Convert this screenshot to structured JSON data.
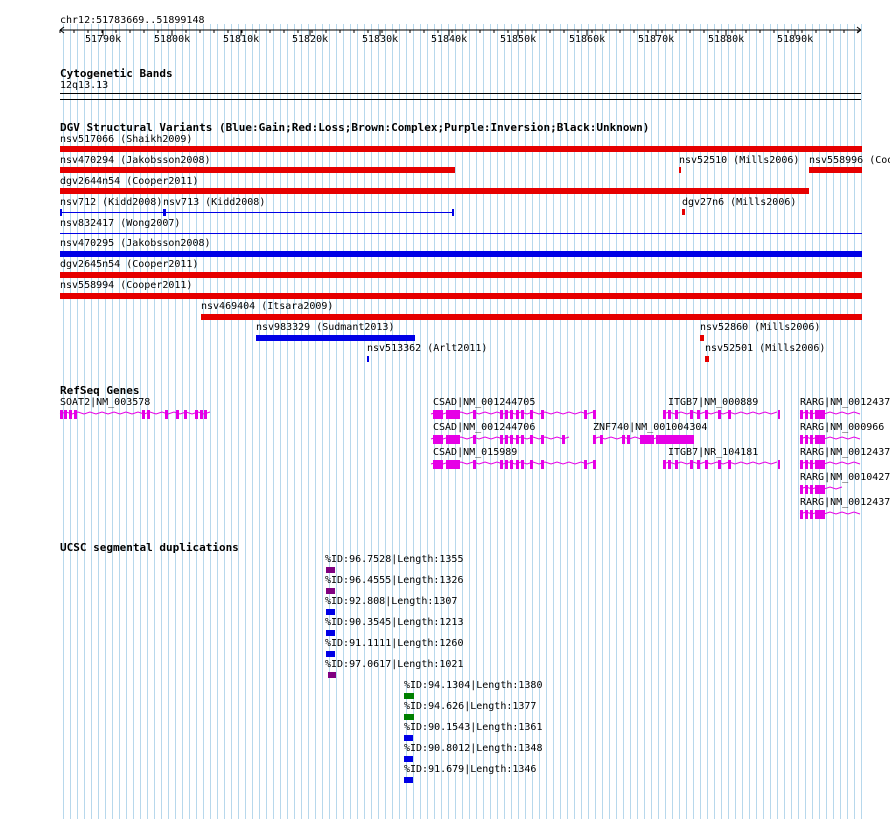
{
  "region": "chr12:51783669..51899148",
  "ruler": {
    "ticks": [
      "51790k",
      "51800k",
      "51810k",
      "51820k",
      "51830k",
      "51840k",
      "51850k",
      "51860k",
      "51870k",
      "51880k",
      "51890k"
    ]
  },
  "cyto": {
    "title": "Cytogenetic Bands",
    "band": "12q13.13"
  },
  "dgv": {
    "title": "DGV Structural Variants (Blue:Gain;Red:Loss;Brown:Complex;Purple:Inversion;Black:Unknown)",
    "variants": [
      {
        "label": "nsv517066 (Shaikh2009)",
        "color": "#e60000"
      },
      {
        "label": "nsv470294 (Jakobsson2008)",
        "color": "#e60000"
      },
      {
        "label": "nsv52510 (Mills2006)",
        "color": "#e60000"
      },
      {
        "label": "nsv558996 (Coo",
        "color": "#e60000"
      },
      {
        "label": "dgv2644n54 (Cooper2011)",
        "color": "#e60000"
      },
      {
        "label": "nsv712 (Kidd2008)",
        "color": "#0000e6"
      },
      {
        "label": "nsv713 (Kidd2008)",
        "color": "#0000e6"
      },
      {
        "label": "dgv27n6 (Mills2006)",
        "color": "#e60000"
      },
      {
        "label": "nsv832417 (Wong2007)",
        "color": "#0000e6"
      },
      {
        "label": "nsv470295 (Jakobsson2008)",
        "color": "#0000e6"
      },
      {
        "label": "dgv2645n54 (Cooper2011)",
        "color": "#e60000"
      },
      {
        "label": "nsv558994 (Cooper2011)",
        "color": "#e60000"
      },
      {
        "label": "nsv469404 (Itsara2009)",
        "color": "#e60000"
      },
      {
        "label": "nsv983329 (Sudmant2013)",
        "color": "#0000e6"
      },
      {
        "label": "nsv52860 (Mills2006)",
        "color": "#e60000"
      },
      {
        "label": "nsv513362 (Arlt2011)",
        "color": "#0000e6"
      },
      {
        "label": "nsv52501 (Mills2006)",
        "color": "#e60000"
      }
    ]
  },
  "refseq": {
    "title": "RefSeq Genes",
    "genes": [
      "SOAT2|NM_003578",
      "CSAD|NM_001244705",
      "ITGB7|NM_000889",
      "RARG|NM_0012437",
      "CSAD|NM_001244706",
      "ZNF740|NM_001004304",
      "RARG|NM_000966",
      "CSAD|NM_015989",
      "ITGB7|NR_104181",
      "RARG|NM_0012437",
      "RARG|NM_0010427",
      "RARG|NM_0012437"
    ],
    "color": "#e600e6"
  },
  "segdup": {
    "title": "UCSC segmental duplications",
    "items": [
      {
        "label": "%ID:96.7528|Length:1355",
        "color": "#800080"
      },
      {
        "label": "%ID:96.4555|Length:1326",
        "color": "#800080"
      },
      {
        "label": "%ID:92.808|Length:1307",
        "color": "#0000e6"
      },
      {
        "label": "%ID:90.3545|Length:1213",
        "color": "#0000e6"
      },
      {
        "label": "%ID:91.1111|Length:1260",
        "color": "#0000e6"
      },
      {
        "label": "%ID:97.0617|Length:1021",
        "color": "#800080"
      },
      {
        "label": "%ID:94.1304|Length:1380",
        "color": "#008000"
      },
      {
        "label": "%ID:94.626|Length:1377",
        "color": "#008000"
      },
      {
        "label": "%ID:90.1543|Length:1361",
        "color": "#0000e6"
      },
      {
        "label": "%ID:90.8012|Length:1348",
        "color": "#0000e6"
      },
      {
        "label": "%ID:91.679|Length:1346",
        "color": "#0000e6"
      }
    ]
  }
}
